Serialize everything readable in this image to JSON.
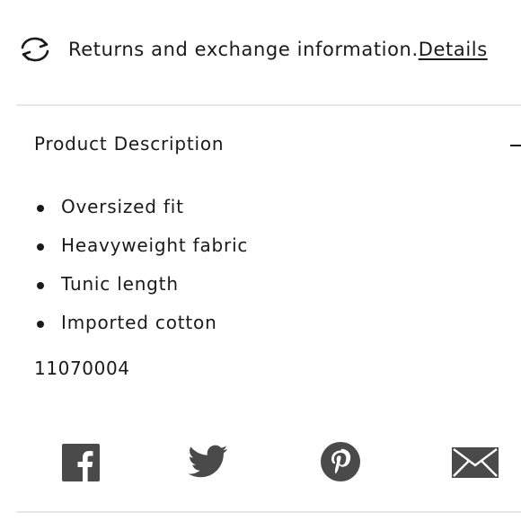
{
  "returns": {
    "text": "Returns and exchange information.",
    "details_link": "Details"
  },
  "product_description": {
    "title": "Product Description",
    "expanded": true,
    "bullets": [
      "Oversized fit",
      "Heavyweight fabric",
      "Tunic length",
      "Imported cotton"
    ],
    "sku": "11070004"
  },
  "share": {
    "icons": [
      "facebook-icon",
      "twitter-icon",
      "pinterest-icon",
      "email-icon"
    ]
  },
  "colors": {
    "text": "#1a1a1a",
    "icon_gray": "#4a4a4a",
    "divider": "#e6e6e6"
  }
}
